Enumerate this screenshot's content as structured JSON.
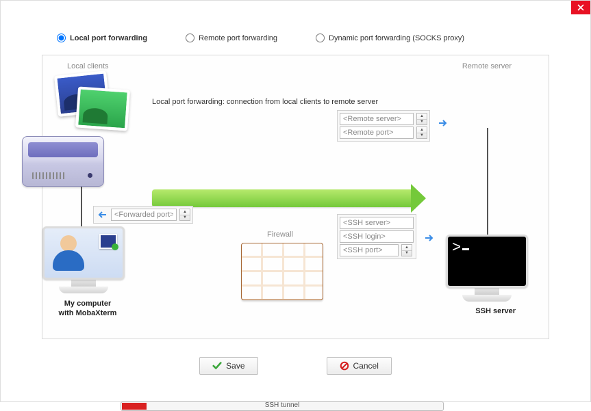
{
  "radios": {
    "local": "Local port forwarding",
    "remote": "Remote port forwarding",
    "dynamic": "Dynamic port forwarding (SOCKS proxy)"
  },
  "labels": {
    "local_clients": "Local clients",
    "remote_server": "Remote server",
    "firewall": "Firewall",
    "my_computer_l1": "My computer",
    "my_computer_l2": "with MobaXterm",
    "ssh_server": "SSH server",
    "arrow_caption": "Local port forwarding: connection from local clients to remote server",
    "ssh_tunnel": "SSH tunnel"
  },
  "fields": {
    "forwarded_port": "<Forwarded port>",
    "remote_server": "<Remote server>",
    "remote_port": "<Remote port>",
    "ssh_server": "<SSH server>",
    "ssh_login": "<SSH login>",
    "ssh_port": "<SSH port>"
  },
  "buttons": {
    "save": "Save",
    "cancel": "Cancel"
  },
  "term_prompt": ">"
}
